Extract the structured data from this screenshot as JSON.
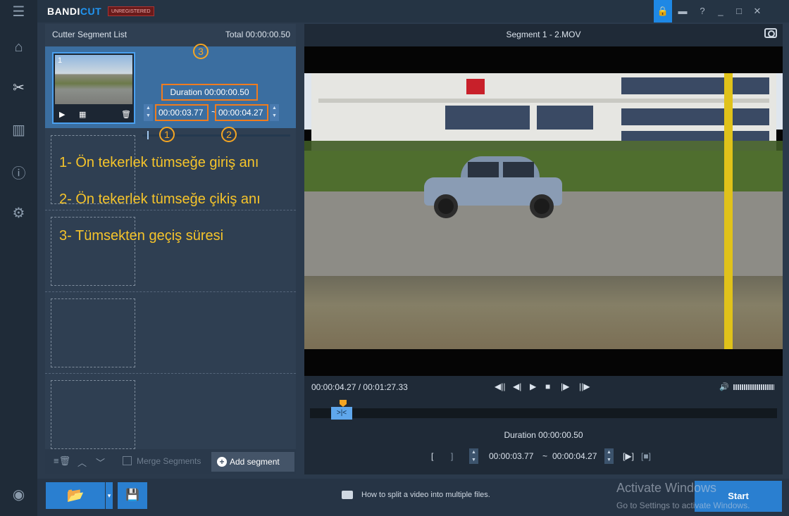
{
  "app": {
    "logo_a": "BANDI",
    "logo_b": "CUT",
    "badge": "UNREGISTERED"
  },
  "rail": {
    "icons": [
      "menu-icon",
      "home-icon",
      "cutter-icon",
      "segments-icon",
      "info-icon",
      "settings-icon",
      "record-icon"
    ]
  },
  "window": {
    "controls": [
      "lock-icon",
      "folder-icon",
      "help-icon",
      "minimize-icon",
      "maximize-icon",
      "close-icon"
    ],
    "help": "?",
    "minimize": "_",
    "maximize": "□",
    "close": "✕"
  },
  "segment_list": {
    "title": "Cutter Segment List",
    "total": "Total 00:00:00.50",
    "segment": {
      "number": "1",
      "duration": "Duration 00:00:00.50",
      "start": "00:00:03.77",
      "separator": "~",
      "end": "00:00:04.27"
    },
    "callouts": [
      "1",
      "2",
      "3"
    ]
  },
  "annotations": [
    "1- Ön tekerlek tümseğe giriş anı",
    "2- Ön tekerlek tümseğe çikiş anı",
    "3- Tümsekten geçiş süresi"
  ],
  "footer": {
    "merge_label": "Merge Segments",
    "add_label": "Add segment"
  },
  "player": {
    "title": "Segment 1 - 2.MOV",
    "time": "00:00:04.27 / 00:01:27.33",
    "duration": "Duration 00:00:00.50",
    "start": "00:00:03.77",
    "separator": "~",
    "end": "00:00:04.27"
  },
  "bottom": {
    "help_text": "How to split a video into multiple files.",
    "start_label": "Start",
    "watermark_title": "Activate Windows",
    "watermark_sub": "Go to Settings to activate Windows."
  },
  "colors": {
    "accent": "#2a7fd0",
    "highlight": "#f07c1e",
    "annotation": "#f6c42a",
    "selected_segment": "#3b6ea0"
  }
}
